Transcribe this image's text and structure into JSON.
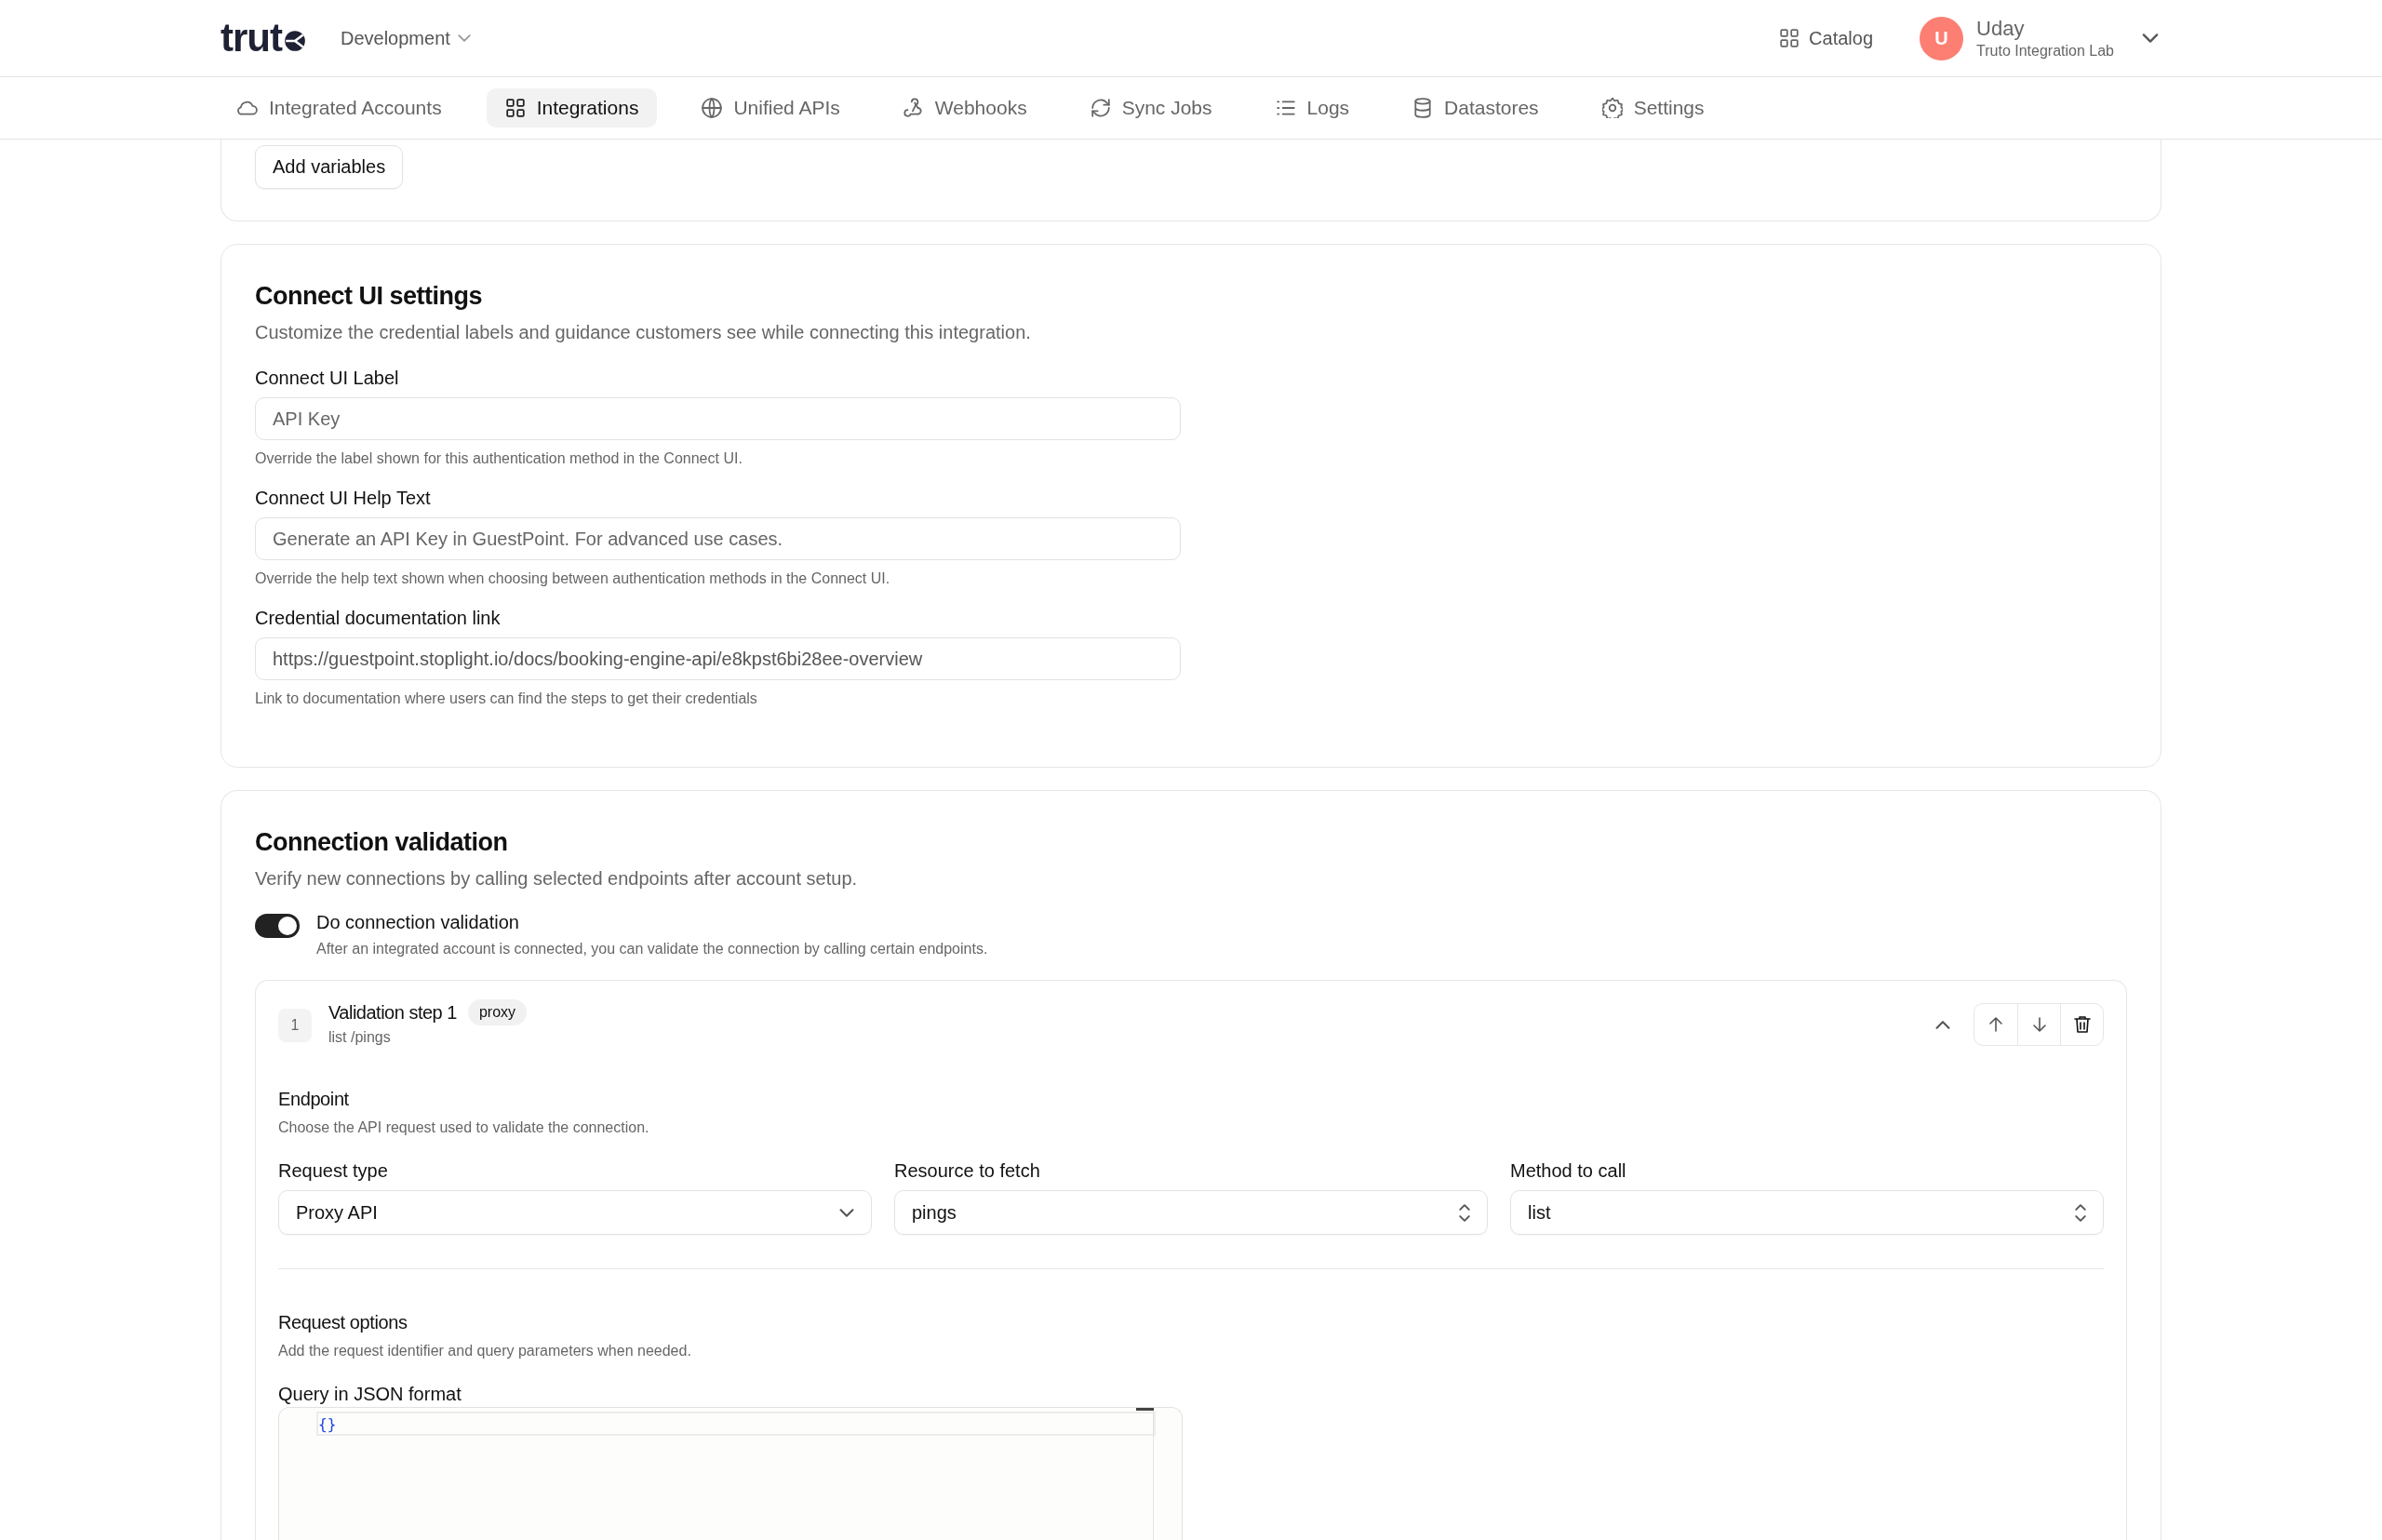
{
  "header": {
    "logo": "trut",
    "environment": "Development",
    "catalog": "Catalog",
    "user": {
      "initial": "U",
      "name": "Uday",
      "org": "Truto Integration Lab"
    }
  },
  "nav": [
    {
      "label": "Integrated Accounts",
      "selected": false
    },
    {
      "label": "Integrations",
      "selected": true
    },
    {
      "label": "Unified APIs",
      "selected": false
    },
    {
      "label": "Webhooks",
      "selected": false
    },
    {
      "label": "Sync Jobs",
      "selected": false
    },
    {
      "label": "Logs",
      "selected": false
    },
    {
      "label": "Datastores",
      "selected": false
    },
    {
      "label": "Settings",
      "selected": false
    }
  ],
  "variables_card": {
    "button": "Add variables"
  },
  "connect_ui": {
    "title": "Connect UI settings",
    "description": "Customize the credential labels and guidance customers see while connecting this integration.",
    "fields": [
      {
        "label": "Connect UI Label",
        "placeholder": "API Key",
        "help": "Override the label shown for this authentication method in the Connect UI."
      },
      {
        "label": "Connect UI Help Text",
        "placeholder": "Generate an API Key in GuestPoint. For advanced use cases.",
        "help": "Override the help text shown when choosing between authentication methods in the Connect UI."
      },
      {
        "label": "Credential documentation link",
        "value": "https://guestpoint.stoplight.io/docs/booking-engine-api/e8kpst6bi28ee-overview",
        "help": "Link to documentation where users can find the steps to get their credentials"
      }
    ]
  },
  "validation": {
    "title": "Connection validation",
    "description": "Verify new connections by calling selected endpoints after account setup.",
    "toggle": {
      "label": "Do connection validation",
      "description": "After an integrated account is connected, you can validate the connection by calling certain endpoints.",
      "on": true
    },
    "steps": [
      {
        "number": "1",
        "title": "Validation step 1",
        "badge": "proxy",
        "subtitle": "list /pings",
        "expanded": true,
        "endpoint": {
          "title": "Endpoint",
          "description": "Choose the API request used to validate the connection."
        },
        "selects": [
          {
            "label": "Request type",
            "value": "Proxy API",
            "kind": "dropdown"
          },
          {
            "label": "Resource to fetch",
            "value": "pings",
            "kind": "combobox"
          },
          {
            "label": "Method to call",
            "value": "list",
            "kind": "combobox"
          }
        ],
        "options": {
          "title": "Request options",
          "description": "Add the request identifier and query parameters when needed."
        },
        "query": {
          "label": "Query in JSON format",
          "code": "{}"
        }
      }
    ]
  }
}
